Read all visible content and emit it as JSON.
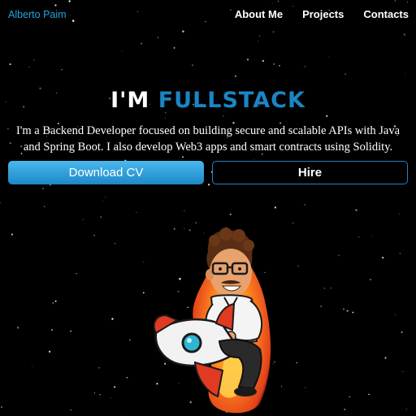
{
  "brand": {
    "name": "Alberto Paim"
  },
  "nav": {
    "links": [
      "About Me",
      "Projects",
      "Contacts"
    ]
  },
  "hero": {
    "headline_prefix": "I'M",
    "headline_accent": "FULLSTACK",
    "description": "I'm a Backend Developer focused on building secure and scalable APIs with Java and Spring Boot. I also develop Web3 apps and smart contracts using Solidity.",
    "primary_button": "Download CV",
    "secondary_button": "Hire",
    "illustration_icon": "developer-riding-rocket-icon"
  },
  "colors": {
    "background": "#000000",
    "accent": "#1a86c4",
    "brand": "#22a6e0",
    "button_gradient_top": "#4ab8ef",
    "button_gradient_bottom": "#1d88c6",
    "outline_border": "#2a7ec0"
  }
}
